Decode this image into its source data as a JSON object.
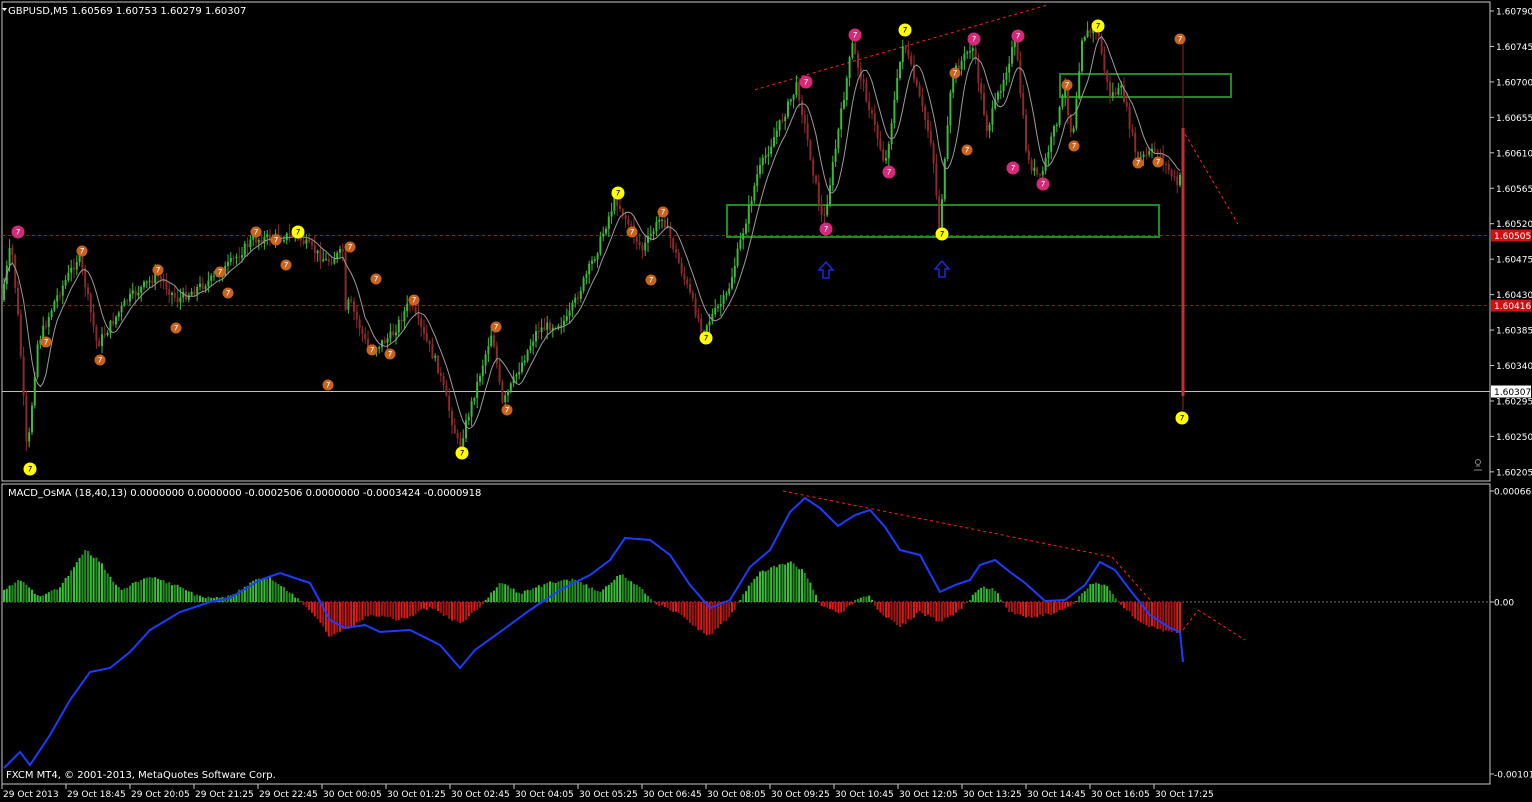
{
  "colors": {
    "background": "#000000",
    "frame": "#c8c8c8",
    "text": "#ffffff",
    "bull_candle": "#3cb93c",
    "bear_candle": "#8c2a2a",
    "moving_average": "#9a9a9a",
    "fractal_magenta": "#d6297a",
    "fractal_orange": "#c8641e",
    "fractal_yellow": "#ffff00",
    "zone_box": "#1e8c1e",
    "trendline": "#ff2020",
    "macd_line": "#1c3cff",
    "hist_positive": "#36c236",
    "hist_negative": "#e01818",
    "price_tag_red": "#d01010"
  },
  "main_chart": {
    "header": "GBPUSD,M5  1.60569 1.60753 1.60279 1.60307",
    "menu_icon": "triangle-down-icon",
    "price_axis_labels": [
      "1.60790",
      "1.60745",
      "1.60700",
      "1.60655",
      "1.60610",
      "1.60565",
      "1.60520",
      "1.60475",
      "1.60430",
      "1.60385",
      "1.60340",
      "1.60295",
      "1.60250",
      "1.60205"
    ],
    "tags": [
      {
        "label": "1.60505",
        "style": "red"
      },
      {
        "label": "1.60416",
        "style": "red"
      },
      {
        "label": "1.60307",
        "style": "white"
      }
    ],
    "upper_trendline_price_start": 1.6069,
    "upper_trendline_price_end": 1.608,
    "corner_icon": "sleeping-expert-icon"
  },
  "indicator": {
    "header": "MACD_OsMA (18,40,13) 0.0000000 0.0000000 -0.0002506 0.0000000 -0.0003424 -0.0000918",
    "axis_labels": [
      "0.000660",
      "0.00",
      "-0.001015"
    ],
    "zero_value": 0.0
  },
  "footer": {
    "copyright": "FXCM MT4, © 2001-2013, MetaQuotes Software Corp."
  },
  "time_axis": [
    "29 Oct 2013",
    "29 Oct 18:45",
    "29 Oct 20:05",
    "29 Oct 21:25",
    "29 Oct 22:45",
    "30 Oct 00:05",
    "30 Oct 01:25",
    "30 Oct 02:45",
    "30 Oct 04:05",
    "30 Oct 05:25",
    "30 Oct 06:45",
    "30 Oct 08:05",
    "30 Oct 09:25",
    "30 Oct 10:45",
    "30 Oct 12:05",
    "30 Oct 13:25",
    "30 Oct 14:45",
    "30 Oct 16:05",
    "30 Oct 17:25"
  ]
}
